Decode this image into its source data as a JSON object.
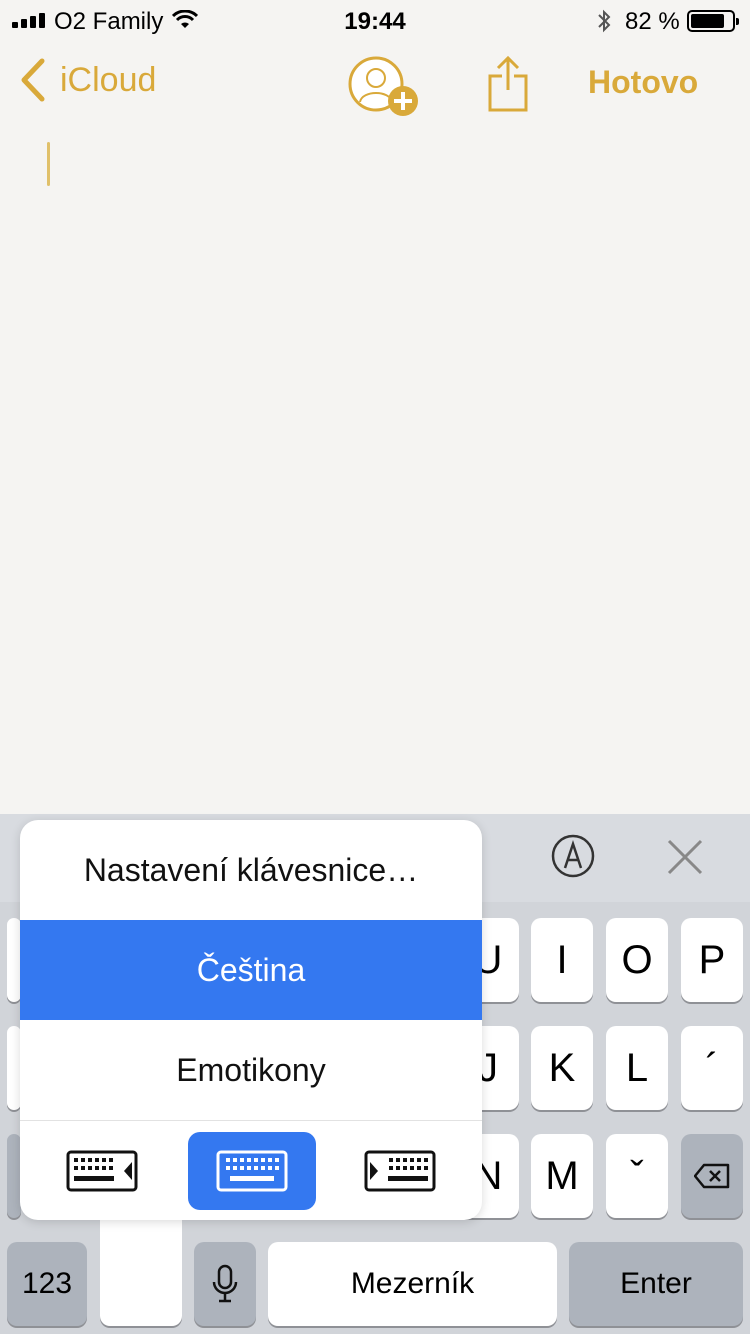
{
  "status_bar": {
    "carrier": "O2 Family",
    "time": "19:44",
    "battery_percent": "82 %",
    "battery_level": 0.82
  },
  "nav": {
    "back_label": "iCloud",
    "done_label": "Hotovo",
    "accent_color": "#d9a93a"
  },
  "keyboard": {
    "letters_row1": [
      "U",
      "I",
      "O",
      "P"
    ],
    "letters_row2": [
      "J",
      "K",
      "L",
      "´"
    ],
    "letters_row3": [
      "N",
      "M",
      "ˇ"
    ],
    "numbers_key": "123",
    "space_label": "Mezerník",
    "enter_label": "Enter"
  },
  "popup": {
    "items": [
      {
        "label": "Nastavení klávesnice…",
        "selected": false
      },
      {
        "label": "Čeština",
        "selected": true
      },
      {
        "label": "Emotikony",
        "selected": false
      }
    ],
    "modes": [
      "keyboard-left-icon",
      "keyboard-full-icon",
      "keyboard-right-icon"
    ],
    "active_mode": 1,
    "selected_color": "#3478f0"
  }
}
